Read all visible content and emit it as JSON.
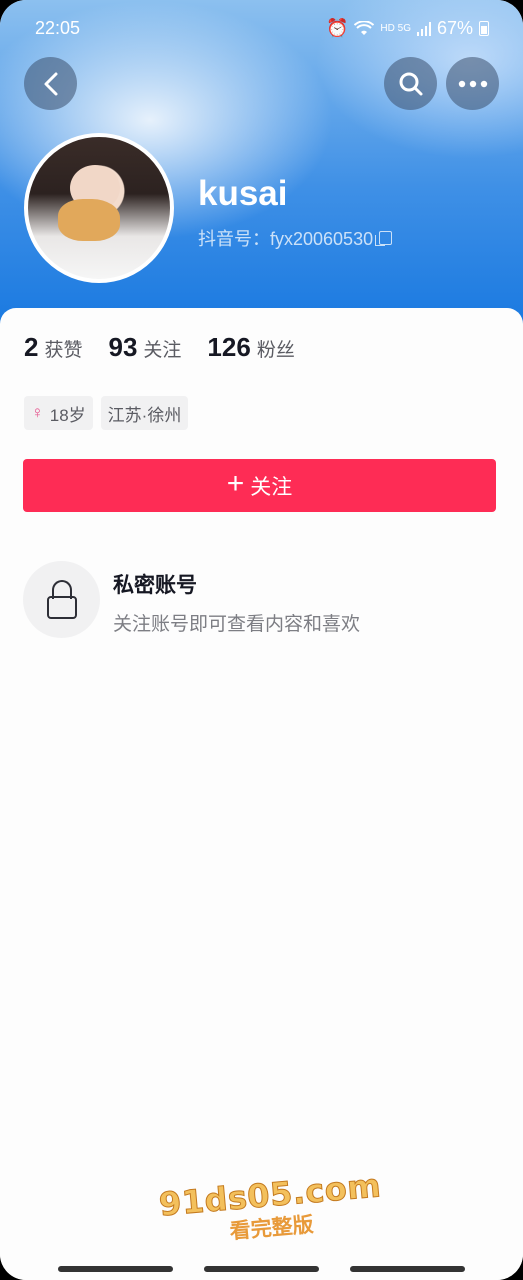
{
  "status_bar": {
    "time": "22:05",
    "signal_text": "HD 5G",
    "battery": "67%"
  },
  "profile": {
    "username": "kusai",
    "douyin_id": "抖音号：fyx20060530"
  },
  "stats": [
    {
      "num": "2",
      "label": "获赞"
    },
    {
      "num": "93",
      "label": "关注"
    },
    {
      "num": "126",
      "label": "粉丝"
    }
  ],
  "tags": {
    "age": "18岁",
    "location": "江苏·徐州"
  },
  "follow_button": {
    "label": "关注"
  },
  "private_account": {
    "title": "私密账号",
    "description": "关注账号即可查看内容和喜欢"
  },
  "watermark": {
    "url": "91ds05.com",
    "sub": "看完整版"
  },
  "colors": {
    "accent": "#fe2c55",
    "header_blue": "#1677e0"
  },
  "icons": [
    "back-icon",
    "search-icon",
    "more-icon",
    "copy-icon",
    "female-icon",
    "plus-icon",
    "lock-icon"
  ]
}
